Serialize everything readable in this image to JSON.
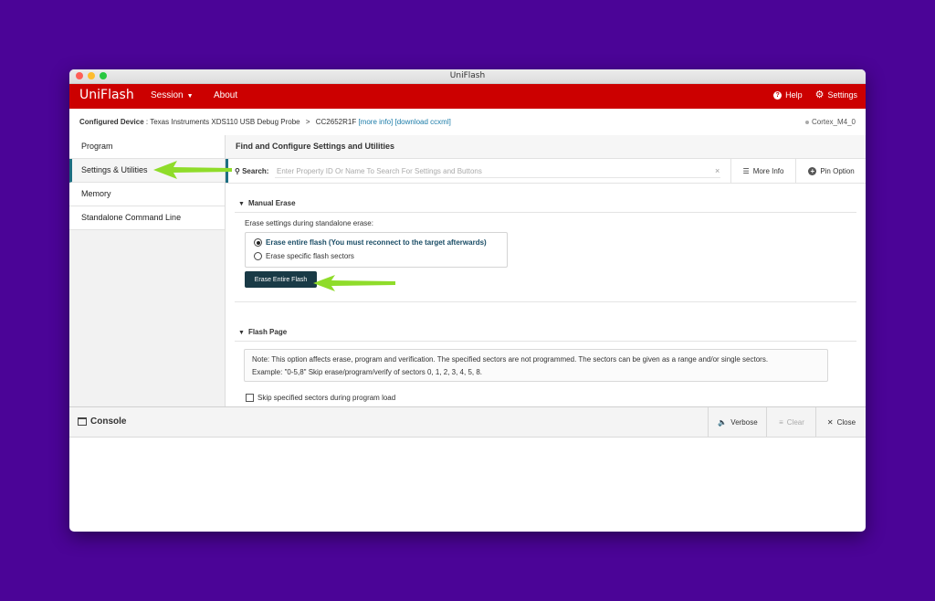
{
  "window": {
    "title": "UniFlash"
  },
  "appbar": {
    "brand": "UniFlash",
    "session_label": "Session",
    "about_label": "About",
    "help_label": "Help",
    "settings_label": "Settings"
  },
  "device": {
    "label": "Configured Device",
    "separator": " : ",
    "value": "Texas Instruments XDS110 USB Debug Probe",
    "chevron": ">",
    "chip": "CC2652R1F",
    "more_info_link": "[more info]",
    "download_link": "[download ccxml]",
    "core": "Cortex_M4_0"
  },
  "sidebar": {
    "items": [
      {
        "label": "Program"
      },
      {
        "label": "Settings & Utilities"
      },
      {
        "label": "Memory"
      },
      {
        "label": "Standalone Command Line"
      }
    ]
  },
  "main": {
    "header": "Find and Configure Settings and Utilities",
    "search_label": "Search:",
    "search_placeholder": "Enter Property ID Or Name To Search For Settings and Buttons",
    "clear_glyph": "×",
    "more_info_label": "More Info",
    "pin_option_label": "Pin Option",
    "manual_erase": {
      "title": "Manual Erase",
      "settings_label": "Erase settings during standalone erase:",
      "options": [
        {
          "label": "Erase entire flash (You must reconnect to the target afterwards)",
          "selected": true
        },
        {
          "label": "Erase specific flash sectors",
          "selected": false
        }
      ],
      "button_label": "Erase Entire Flash"
    },
    "flash_page": {
      "title": "Flash Page",
      "note_line1": "Note: This option affects erase, program and verification. The specified sectors are not programmed. The sectors can be given as a range and/or single sectors.",
      "note_line2": "Example: \"0-5,8\" Skip erase/program/verify of sectors 0, 1, 2, 3, 4, 5, 8.",
      "checkbox_label": "Skip specified sectors during program load",
      "checked": false
    }
  },
  "console": {
    "title": "Console",
    "verbose_label": "Verbose",
    "clear_label": "Clear",
    "close_label": "Close"
  },
  "colors": {
    "background": "#4b0497",
    "brand_red": "#cc0000",
    "accent_teal": "#1d6e82",
    "button_dark": "#193a46",
    "annotation_arrow": "#8fdc2a"
  },
  "icons": [
    "help-circle-icon",
    "gear-icon",
    "search-icon",
    "list-icon",
    "plus-circle-icon",
    "console-window-icon",
    "speaker-icon",
    "clear-lines-icon",
    "close-icon",
    "caret-down-icon",
    "triangle-down-icon",
    "annotation-arrow-icon"
  ]
}
